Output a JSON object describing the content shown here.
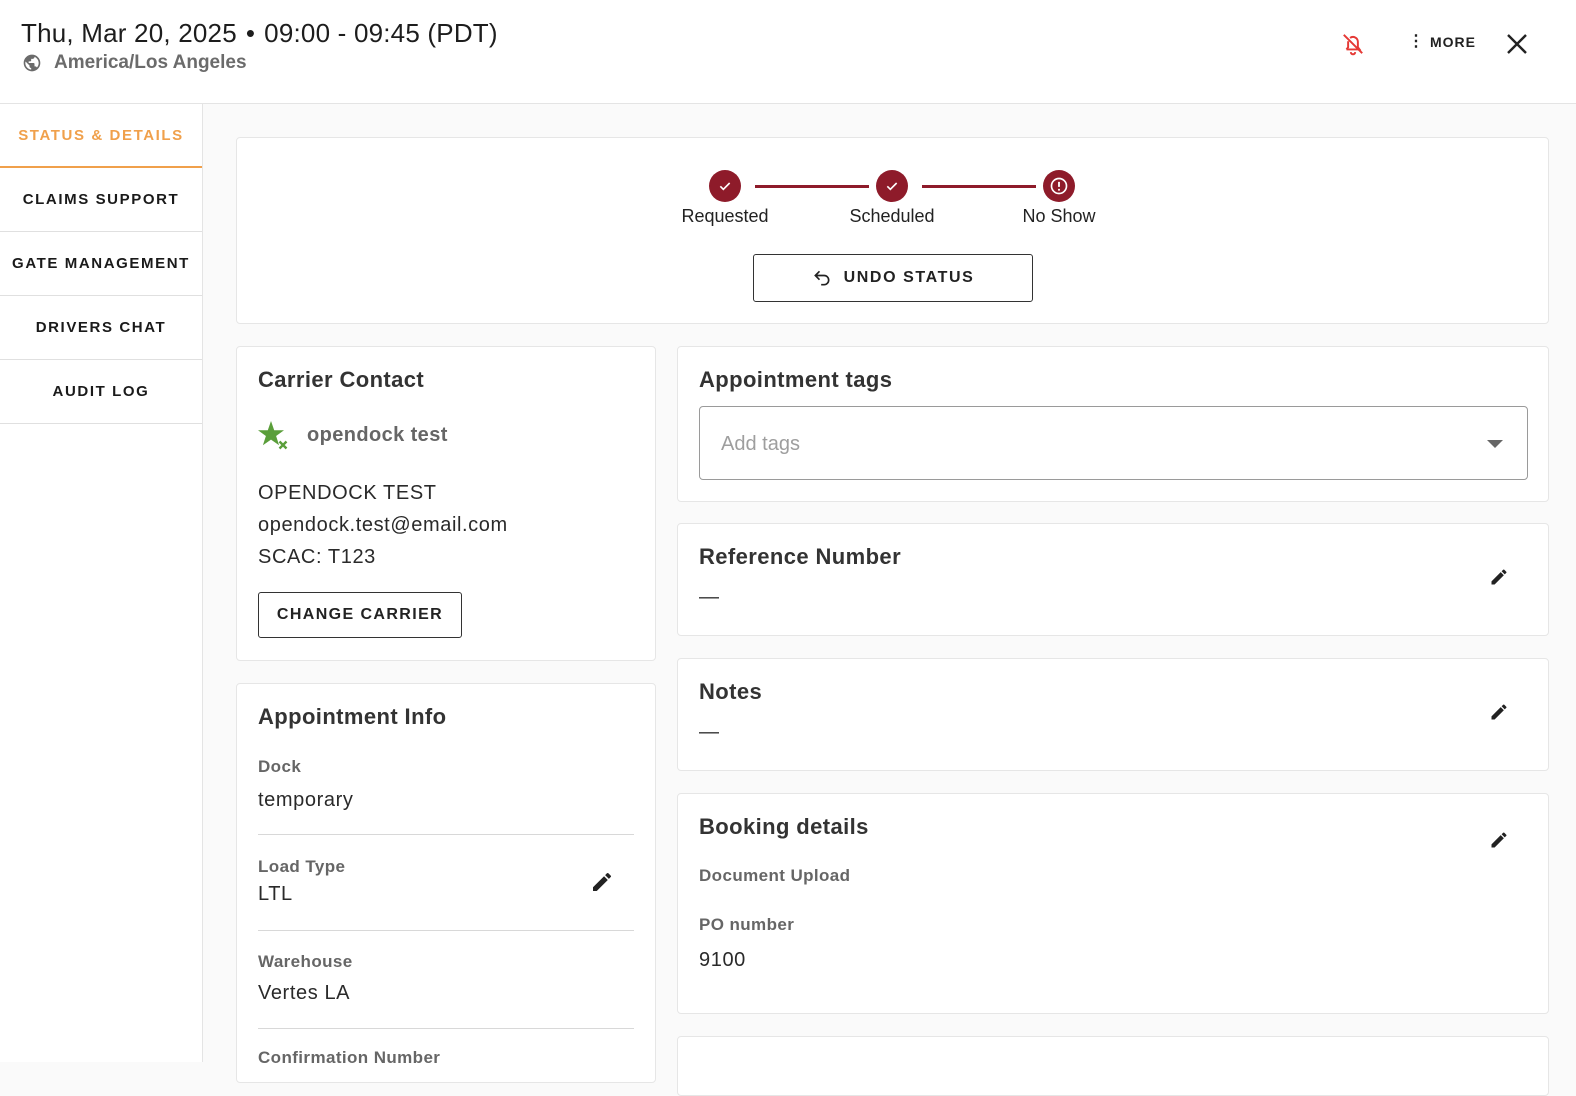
{
  "header": {
    "date": "Thu, Mar 20, 2025",
    "time": "09:00 - 09:45 (PDT)",
    "timezone": "America/Los Angeles",
    "more_label": "MORE",
    "icons": {
      "notifications": "bell-off-icon",
      "more": "more-vert-icon",
      "close": "close-icon",
      "timezone": "globe-icon"
    },
    "colors": {
      "bell_off": "#e53935"
    }
  },
  "sidebar": {
    "items": [
      {
        "label": "STATUS & DETAILS",
        "active": true
      },
      {
        "label": "CLAIMS SUPPORT",
        "active": false
      },
      {
        "label": "GATE MANAGEMENT",
        "active": false
      },
      {
        "label": "DRIVERS CHAT",
        "active": false
      },
      {
        "label": "AUDIT LOG",
        "active": false
      }
    ],
    "active_color": "#f0a04b"
  },
  "status": {
    "steps": [
      {
        "label": "Requested",
        "state": "done"
      },
      {
        "label": "Scheduled",
        "state": "done"
      },
      {
        "label": "No Show",
        "state": "alert"
      }
    ],
    "undo_label": "UNDO STATUS",
    "color": "#8e1b2a"
  },
  "carrier": {
    "title": "Carrier Contact",
    "name": "opendock test",
    "company": "OPENDOCK TEST",
    "email": "opendock.test@email.com",
    "scac": "SCAC: T123",
    "change_label": "CHANGE CARRIER",
    "badge_icon": "star-remove-icon"
  },
  "appointment_info": {
    "title": "Appointment Info",
    "dock_label": "Dock",
    "dock_value": "temporary",
    "load_type_label": "Load Type",
    "load_type_value": "LTL",
    "warehouse_label": "Warehouse",
    "warehouse_value": "Vertes LA",
    "confirmation_label": "Confirmation Number"
  },
  "tags": {
    "title": "Appointment tags",
    "placeholder": "Add tags"
  },
  "reference": {
    "title": "Reference Number",
    "value": "—"
  },
  "notes": {
    "title": "Notes",
    "value": "—"
  },
  "booking": {
    "title": "Booking details",
    "doc_upload_label": "Document Upload",
    "po_label": "PO number",
    "po_value": "9100"
  }
}
